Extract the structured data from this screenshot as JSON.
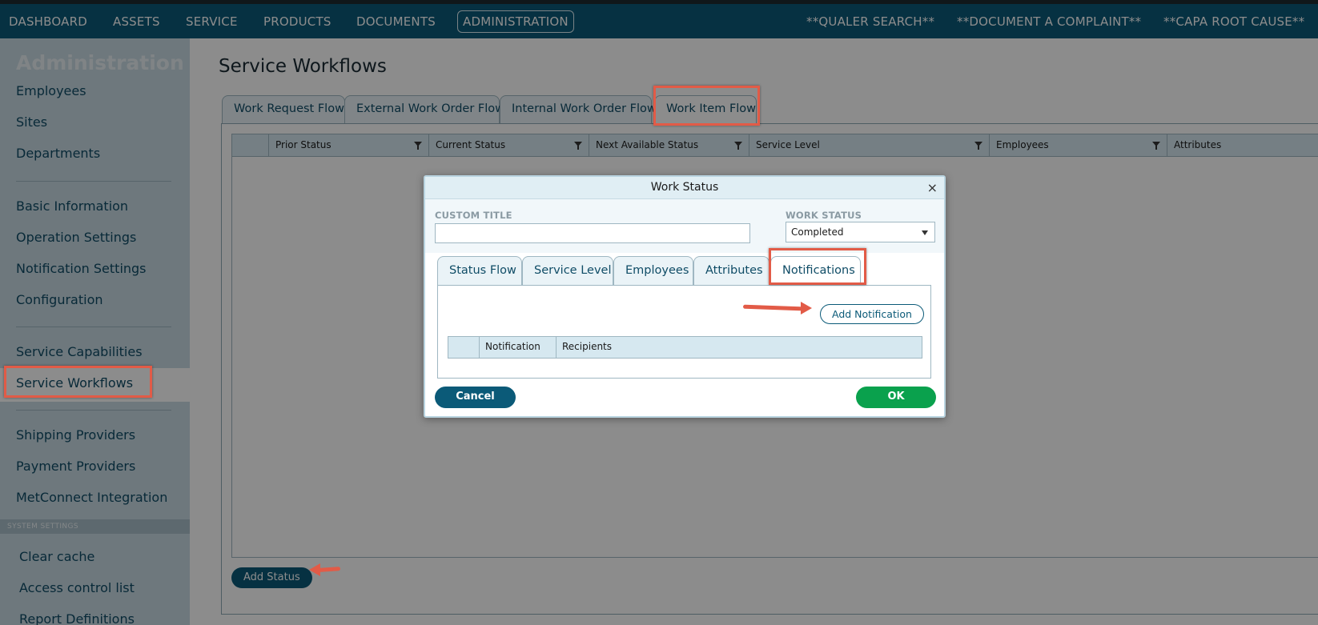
{
  "top_nav": {
    "items": [
      "DASHBOARD",
      "ASSETS",
      "SERVICE",
      "PRODUCTS",
      "DOCUMENTS",
      "ADMINISTRATION"
    ],
    "active": "ADMINISTRATION",
    "quick_links": [
      "**QUALER SEARCH**",
      "**DOCUMENT A COMPLAINT**",
      "**CAPA ROOT CAUSE**"
    ]
  },
  "sidebar": {
    "title": "Administration",
    "group1": [
      "Employees",
      "Sites",
      "Departments"
    ],
    "group2": [
      "Basic Information",
      "Operation Settings",
      "Notification Settings",
      "Configuration"
    ],
    "group3": [
      "Service Capabilities",
      "Service Workflows"
    ],
    "selected": "Service Workflows",
    "group4": [
      "Shipping Providers",
      "Payment Providers",
      "MetConnect Integration"
    ],
    "system_settings_label": "SYSTEM SETTINGS",
    "system_items": [
      "Clear cache",
      "Access control list",
      "Report Definitions"
    ]
  },
  "main": {
    "title": "Service Workflows",
    "tabs": [
      "Work Request Flow",
      "External Work Order Flow",
      "Internal Work Order Flow",
      "Work Item Flow"
    ],
    "active_tab": "Work Item Flow",
    "grid_columns": [
      "Prior Status",
      "Current Status",
      "Next Available Status",
      "Service Level",
      "Employees",
      "Attributes"
    ],
    "add_status_label": "Add Status"
  },
  "dialog": {
    "title": "Work Status",
    "close_glyph": "×",
    "custom_title_label": "CUSTOM TITLE",
    "custom_title_value": "",
    "work_status_label": "WORK STATUS",
    "work_status_value": "Completed",
    "tabs": [
      "Status Flow",
      "Service Level",
      "Employees",
      "Attributes",
      "Notifications"
    ],
    "active_tab": "Notifications",
    "add_notification_label": "Add Notification",
    "notification_columns": [
      "Notification",
      "Recipients"
    ],
    "cancel_label": "Cancel",
    "ok_label": "OK"
  },
  "colors": {
    "nav_bg": "#0b5a78",
    "accent": "#0b5a78",
    "ok_green": "#0aa14d",
    "annotation_red": "#e25b47"
  }
}
